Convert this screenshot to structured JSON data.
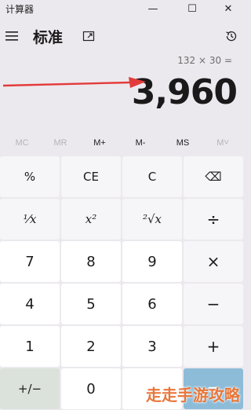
{
  "window": {
    "title": "计算器",
    "minimize_glyph": "—",
    "maximize_glyph": "☐",
    "close_glyph": "✕"
  },
  "header": {
    "mode_title": "标准",
    "menu_icon": "hamburger-menu-icon",
    "keep_on_top_icon": "keep-on-top-icon",
    "history_icon": "history-icon"
  },
  "display": {
    "expression": "132 × 30 =",
    "result": "3,960"
  },
  "memory": {
    "buttons": [
      {
        "label": "MC",
        "enabled": false
      },
      {
        "label": "MR",
        "enabled": false
      },
      {
        "label": "M+",
        "enabled": true
      },
      {
        "label": "M-",
        "enabled": true
      },
      {
        "label": "MS",
        "enabled": true
      },
      {
        "label": "M˅",
        "enabled": false
      }
    ]
  },
  "keypad": {
    "rows": [
      [
        "%",
        "CE",
        "C",
        "⌫"
      ],
      [
        "⅟x",
        "x²",
        "²√x",
        "÷"
      ],
      [
        "7",
        "8",
        "9",
        "×"
      ],
      [
        "4",
        "5",
        "6",
        "−"
      ],
      [
        "1",
        "2",
        "3",
        "+"
      ],
      [
        "+/−",
        "0",
        ".",
        "="
      ]
    ]
  },
  "annotation": {
    "arrow_color": "#e33b3b"
  },
  "watermark": {
    "text": "走走手游攻略"
  },
  "colors": {
    "background": "#ece9ee",
    "digit_key": "#ffffff",
    "function_key": "#f6f5f7",
    "equals_key": "#8dbcd9"
  }
}
